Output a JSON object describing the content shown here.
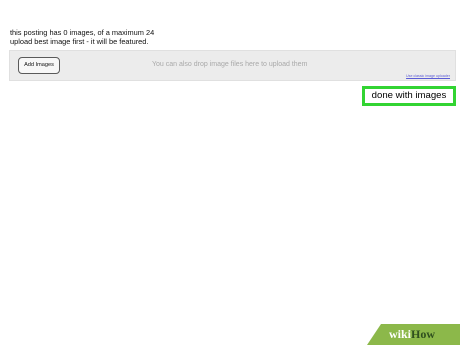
{
  "info": {
    "line1": "this posting has 0 images, of a maximum 24",
    "line2": "upload best image first - it will be featured."
  },
  "upload_panel": {
    "add_images_label": "Add Images",
    "drop_hint": "You can also drop image files here to upload them",
    "classic_link": "Use classic image uploader"
  },
  "done_button": {
    "label": "done with images",
    "highlight_color": "#32d432"
  },
  "watermark": {
    "wiki": "wiki",
    "how": "How",
    "color": "#8cb84a"
  }
}
